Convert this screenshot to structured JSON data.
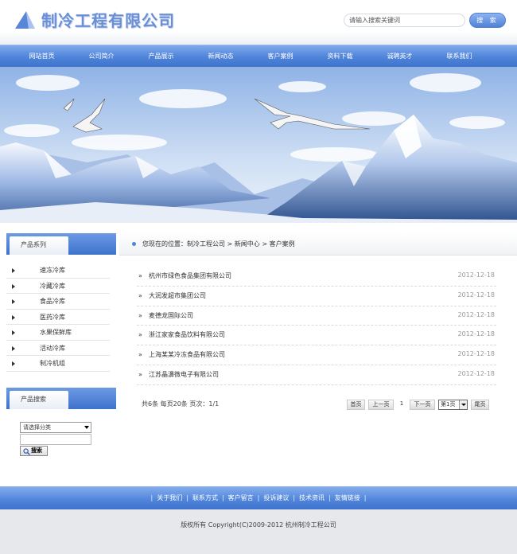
{
  "header": {
    "company_name": "制冷工程有限公司",
    "search_placeholder": "请输入搜索关键词",
    "search_button": "搜 索"
  },
  "nav": {
    "items": [
      "网站首页",
      "公司简介",
      "产品展示",
      "新闻动态",
      "客户案例",
      "资料下载",
      "诚聘英才",
      "联系我们"
    ]
  },
  "sidebar": {
    "categories_title": "产品系列",
    "categories": [
      "速冻冷库",
      "冷藏冷库",
      "食品冷库",
      "医药冷库",
      "水果保鲜库",
      "活动冷库",
      "制冷机组"
    ],
    "search_title": "产品搜索",
    "select_value": "请选择分类",
    "search_button": "搜索"
  },
  "breadcrumb": {
    "text": "您现在的位置：制冷工程公司 > 新闻中心 > 客户案例"
  },
  "news": [
    {
      "title": "杭州市绿色食品集团有限公司",
      "date": "2012-12-18"
    },
    {
      "title": "大润发超市集团公司",
      "date": "2012-12-18"
    },
    {
      "title": "麦德龙国际公司",
      "date": "2012-12-18"
    },
    {
      "title": "浙江家家食品饮料有限公司",
      "date": "2012-12-18"
    },
    {
      "title": "上海某某冷冻食品有限公司",
      "date": "2012-12-18"
    },
    {
      "title": "江苏晶濞微电子有限公司",
      "date": "2012-12-18"
    }
  ],
  "pagination": {
    "info": "共6条  每页20条  页次：1/1",
    "first": "首页",
    "prev": "上一页",
    "current": "1",
    "next": "下一页",
    "select_value": "第1页",
    "last": "尾页"
  },
  "footer": {
    "links": [
      "关于我们",
      "联系方式",
      "客户留言",
      "投诉建议",
      "技术资讯",
      "友情链接"
    ],
    "copyright": "版权所有  Copyright(C)2009-2012 杭州制冷工程公司"
  },
  "colors": {
    "accent": "#4f84da",
    "nav_top": "#7fa9ea",
    "footer_bg": "#e6e8eb"
  }
}
